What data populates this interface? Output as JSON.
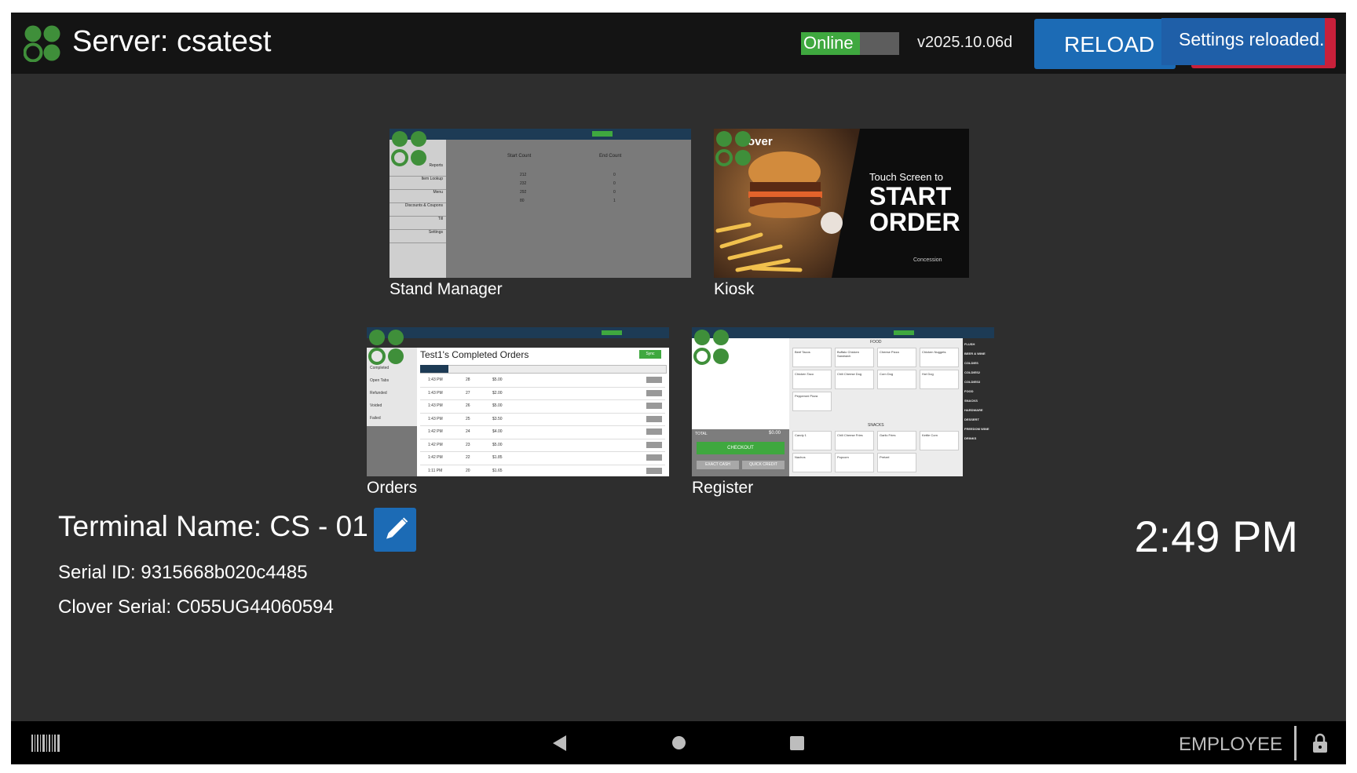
{
  "header": {
    "title": "Server: csatest",
    "status_label": "Online",
    "status_progress": 0.6,
    "version": "v2025.10.06d",
    "reload_label": "RELOAD",
    "toast": "Settings reloaded."
  },
  "apps": [
    {
      "label": "Stand Manager"
    },
    {
      "label": "Kiosk"
    },
    {
      "label": "Orders"
    },
    {
      "label": "Register"
    }
  ],
  "stand_manager_thumb": {
    "menu_items": [
      "Reports",
      "Item Lookup",
      "Menu",
      "Discounts & Coupons",
      "Till",
      "Settings"
    ],
    "col_start": "Start Count",
    "col_end": "End Count",
    "start_counts": [
      "212",
      "232",
      "292",
      "80"
    ],
    "end_counts": [
      "0",
      "0",
      "0",
      "1"
    ]
  },
  "kiosk_thumb": {
    "brand": "over",
    "touch": "Touch Screen to",
    "line1": "START",
    "line2": "ORDER",
    "footer": "Concession"
  },
  "orders_thumb": {
    "title": "Test1's Completed Orders",
    "sync": "Sync",
    "side_items": [
      "Completed",
      "Open Tabs",
      "Refunded",
      "Voided",
      "Failed"
    ],
    "rows": [
      {
        "time": "1:43 PM",
        "num": "28",
        "amt": "$5.00"
      },
      {
        "time": "1:43 PM",
        "num": "27",
        "amt": "$2.00"
      },
      {
        "time": "1:43 PM",
        "num": "26",
        "amt": "$5.00"
      },
      {
        "time": "1:43 PM",
        "num": "25",
        "amt": "$3.50"
      },
      {
        "time": "1:42 PM",
        "num": "24",
        "amt": "$4.00"
      },
      {
        "time": "1:42 PM",
        "num": "23",
        "amt": "$5.00"
      },
      {
        "time": "1:42 PM",
        "num": "22",
        "amt": "$1.85"
      },
      {
        "time": "1:11 PM",
        "num": "20",
        "amt": "$1.65"
      }
    ]
  },
  "register_thumb": {
    "food_header": "FOOD",
    "snacks_header": "SNACKS",
    "food_items": [
      "Beef Tacos",
      "Buffalo Chicken Sandwich",
      "Cheese Pizza",
      "Chicken Nuggets",
      "Chicken Taco",
      "Chili Cheese Dog",
      "Corn Dog",
      "Hot Dog",
      "Pepperoni Pizza"
    ],
    "snack_items": [
      "Candy 1",
      "Chili Cheese Fries",
      "Garlic Fries",
      "Kettle Corn",
      "Nachos",
      "Popcorn",
      "Pretzel"
    ],
    "categories": [
      "FLUSH",
      "BEER & WINE",
      "COLDIES",
      "COLDIES2",
      "COLDIES3",
      "FOOD",
      "SNACKS",
      "HARDWARE",
      "DESSERT",
      "FREEDOM WINE",
      "DRINKS"
    ],
    "total_label": "TOTAL",
    "total_value": "$0.00",
    "checkout": "CHECKOUT",
    "exact_cash": "EXACT CASH",
    "quick_credit": "QUICK CREDIT"
  },
  "terminal": {
    "name": "Terminal Name: CS - 01",
    "serial_id": "Serial ID: 9315668b020c4485",
    "clover_serial": "Clover Serial: C055UG44060594"
  },
  "clock": "2:49 PM",
  "navbar": {
    "employee_label": "EMPLOYEE"
  },
  "colors": {
    "accent_blue": "#1c6bb5",
    "status_green": "#3fa83f",
    "toast_red": "#c8203a",
    "clover_green": "#3f8f3a"
  },
  "icons": [
    "clover-logo-icon",
    "edit-pencil-icon",
    "barcode-icon",
    "back-icon",
    "home-icon",
    "recents-icon",
    "lock-icon"
  ]
}
